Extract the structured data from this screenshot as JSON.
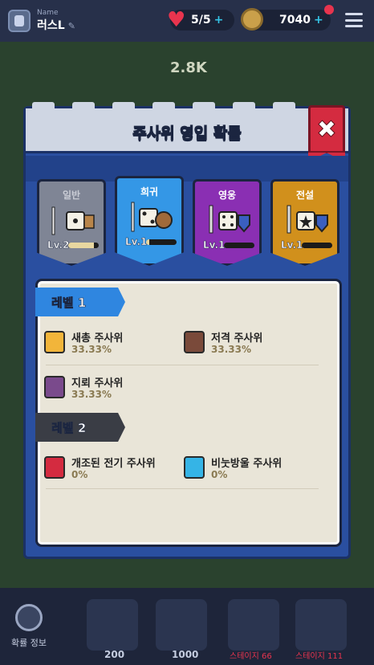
{
  "topbar": {
    "name_label": "Name",
    "name_value": "러스L",
    "hearts": "5/5",
    "coins": "7040"
  },
  "background": {
    "score": "2.8K"
  },
  "bottombar": {
    "prob_label": "확률 정보",
    "price_1": "200",
    "price_2": "1000",
    "stage_1": "스테이지 66",
    "stage_2": "스테이지 111"
  },
  "modal": {
    "title": "주사위 영입 확률",
    "tabs": [
      {
        "label": "일반",
        "level": "Lv.2",
        "progress": 0.85,
        "color": "#7f8595"
      },
      {
        "label": "희귀",
        "level": "Lv.1",
        "progress": 0.1,
        "color": "#3497e6"
      },
      {
        "label": "영웅",
        "level": "Lv.1",
        "progress": 0.0,
        "color": "#8a2fb3"
      },
      {
        "label": "전설",
        "level": "Lv.1",
        "progress": 0.0,
        "color": "#d1901c"
      }
    ],
    "level1": {
      "label": "레벨 1",
      "items": [
        {
          "name": "새총 주사위",
          "prob": "33.33%",
          "icon": "slingshot-icon",
          "color": "#f2b53a"
        },
        {
          "name": "저격 주사위",
          "prob": "33.33%",
          "icon": "sniper-icon",
          "color": "#7a4a3a"
        },
        {
          "name": "지뢰 주사위",
          "prob": "33.33%",
          "icon": "mine-icon",
          "color": "#7a4a8c"
        }
      ]
    },
    "level2": {
      "label": "레벨 2",
      "items": [
        {
          "name": "개조된 전기 주사위",
          "prob": "0%",
          "icon": "electric-icon",
          "color": "#d42b40"
        },
        {
          "name": "비눗방울 주사위",
          "prob": "0%",
          "icon": "bubble-icon",
          "color": "#35b4e6"
        }
      ]
    }
  }
}
